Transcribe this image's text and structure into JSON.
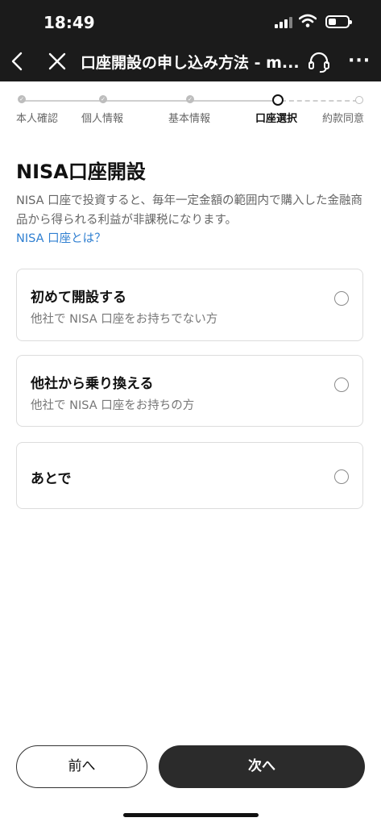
{
  "status_bar": {
    "time": "18:49"
  },
  "nav": {
    "title": "口座開設の申し込み方法 - m...",
    "icons": {
      "back": "chevron-left-icon",
      "close": "close-icon",
      "support": "headset-icon",
      "more": "more-icon"
    },
    "more_glyph": "···"
  },
  "stepper": {
    "steps": [
      {
        "label": "本人確認",
        "state": "done"
      },
      {
        "label": "個人情報",
        "state": "done"
      },
      {
        "label": "基本情報",
        "state": "done"
      },
      {
        "label": "口座選択",
        "state": "current"
      },
      {
        "label": "約款同意",
        "state": "future"
      }
    ],
    "check_glyph": "✓"
  },
  "main": {
    "title": "NISA口座開設",
    "description": "NISA 口座で投資すると、毎年一定金額の範囲内で購入した金融商品から得られる利益が非課税になります。",
    "link": "NISA 口座とは？",
    "options": [
      {
        "title": "初めて開設する",
        "subtitle": "他社で NISA 口座をお持ちでない方",
        "selected": false
      },
      {
        "title": "他社から乗り換える",
        "subtitle": "他社で NISA 口座をお持ちの方",
        "selected": false
      },
      {
        "title": "あとで",
        "subtitle": "",
        "selected": false
      }
    ]
  },
  "footer": {
    "prev_label": "前へ",
    "next_label": "次へ"
  },
  "colors": {
    "topbar": "#1b1b1b",
    "link": "#2f7fd1",
    "primary_button": "#2b2b2b"
  }
}
